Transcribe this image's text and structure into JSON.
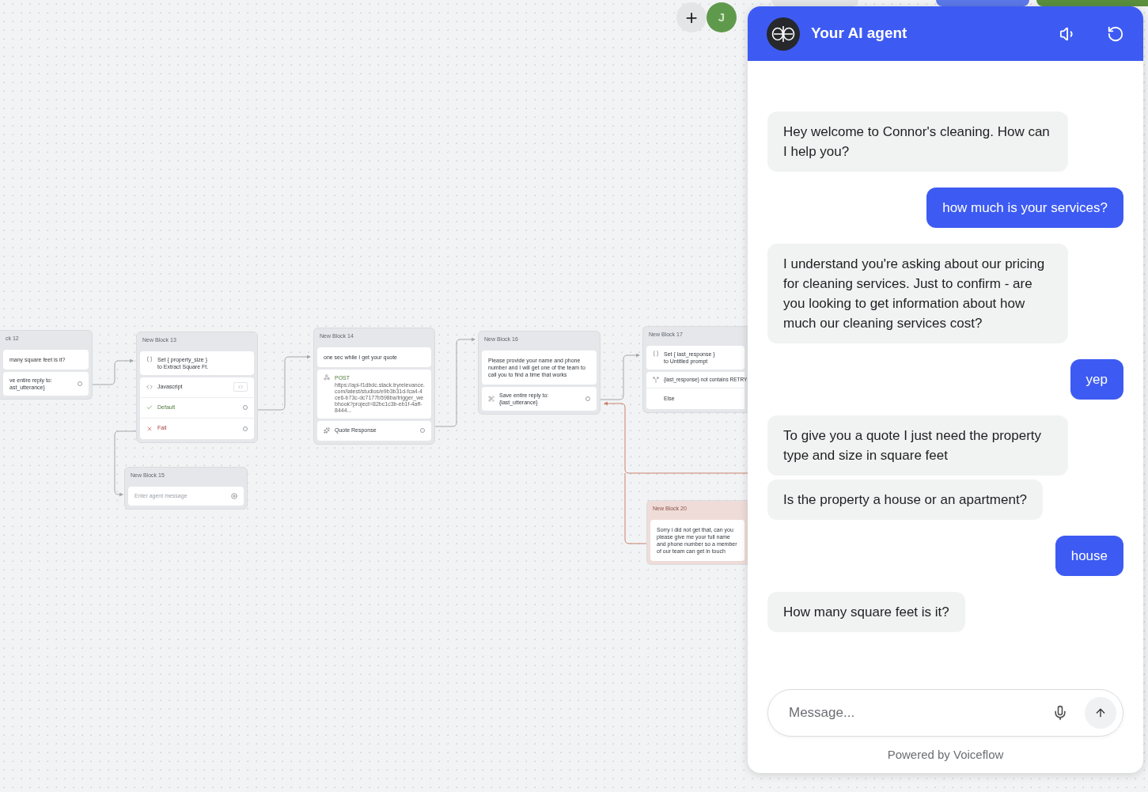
{
  "canvas": {
    "blocks": [
      {
        "title": "ck 12",
        "kind": "normal",
        "steps": [
          {
            "kind": "message",
            "text": "many square feet is it?"
          },
          {
            "kind": "capture",
            "text": "ve entire reply to:",
            "variable": "ast_utterance}"
          }
        ]
      },
      {
        "title": "New Block 13",
        "kind": "normal",
        "steps": [
          {
            "kind": "set",
            "lines": [
              "Set { property_size }",
              "to Extract Square Ft."
            ]
          },
          {
            "kind": "code",
            "text": "Javascript",
            "paths": [
              {
                "label": "Default",
                "kind": "success"
              },
              {
                "label": "Fail",
                "kind": "fail"
              }
            ]
          }
        ]
      },
      {
        "title": "New Block 15",
        "kind": "normal",
        "steps": [
          {
            "kind": "input",
            "placeholder": "Enter agent message"
          }
        ]
      },
      {
        "title": "New Block 14",
        "kind": "normal",
        "steps": [
          {
            "kind": "message",
            "text": "one sec while I get your quote"
          },
          {
            "kind": "api",
            "method": "POST",
            "url": "https://api-f1dbdc.stack.tryrelevance.com/latest/studios/e9b3b31d-fca4-4ce6-b73c-dc7177b598ba/trigger_webhook?project=82bc1c3b-eb1f-4aff-8444..."
          },
          {
            "kind": "response",
            "text": "Quote Response"
          }
        ]
      },
      {
        "title": "New Block 16",
        "kind": "normal",
        "steps": [
          {
            "kind": "message",
            "text": "Please provide your name and phone number and I will get one of the team to call you to find a time that works"
          },
          {
            "kind": "capture",
            "text": "Save entire reply to:",
            "variable": "{last_utterance}"
          }
        ]
      },
      {
        "title": "New Block 17",
        "kind": "normal",
        "steps": [
          {
            "kind": "set",
            "lines": [
              "Set { last_response }",
              "to Untitled prompt"
            ]
          },
          {
            "kind": "condition",
            "text": "{last_response} not contains RETRY",
            "else": "Else"
          }
        ]
      },
      {
        "title": "New Block 20",
        "kind": "error",
        "steps": [
          {
            "kind": "message",
            "text": "Sorry i did not get that, can you please give me your full name and phone number so a member of our team can get in touch"
          }
        ]
      }
    ]
  },
  "toolbar": {
    "avatar": "J",
    "add": "+"
  },
  "chat": {
    "title": "Your AI agent",
    "messages": [
      {
        "kind": "agent",
        "text": "Hey welcome to Connor's cleaning. How can I help you?"
      },
      {
        "kind": "user",
        "text": "how much is your services?"
      },
      {
        "kind": "agent",
        "text": "I understand you're asking about our pricing for cleaning services. Just to confirm - are you looking to get information about how much our cleaning services cost?"
      },
      {
        "kind": "user",
        "text": "yep"
      },
      {
        "kind": "agent",
        "text": "To give you a quote I just need the property type and size in square feet"
      },
      {
        "kind": "agent",
        "text": "Is the property a house or an apartment?"
      },
      {
        "kind": "user",
        "text": "house"
      },
      {
        "kind": "agent",
        "text": "How many square feet is it?"
      }
    ],
    "input": {
      "placeholder": "Message..."
    },
    "footer": "Powered by Voiceflow"
  }
}
